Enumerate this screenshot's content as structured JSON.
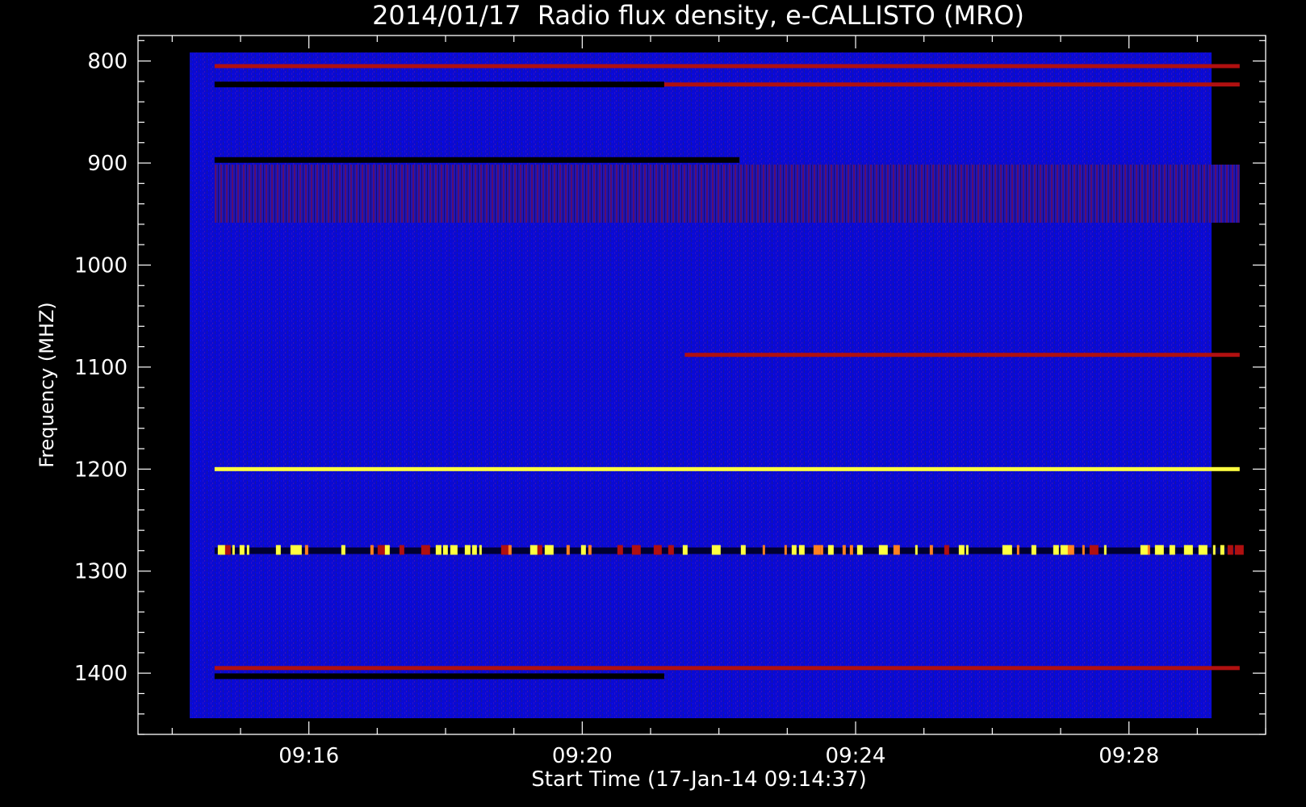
{
  "chart_data": {
    "type": "heatmap",
    "title": "2014/01/17  Radio flux density, e-CALLISTO (MRO)",
    "xlabel": "Start Time (17-Jan-14 09:14:37)",
    "ylabel": "Frequency (MHZ)",
    "x_range": [
      "09:14:37",
      "09:29:37"
    ],
    "xlim_minutes": [
      13.5,
      30.0
    ],
    "ylim": [
      1460,
      775
    ],
    "y_inverted": true,
    "x_ticks": [
      "09:16",
      "09:20",
      "09:24",
      "09:28"
    ],
    "x_tick_minutes": [
      16,
      20,
      24,
      28
    ],
    "y_ticks": [
      "800",
      "900",
      "1000",
      "1100",
      "1200",
      "1300",
      "1400"
    ],
    "y_tick_values": [
      800,
      900,
      1000,
      1100,
      1200,
      1300,
      1400
    ],
    "data_freq_range": [
      790,
      1450
    ],
    "colors": {
      "background": "#0a0ad2",
      "low": "#000000",
      "mid": "#b01010",
      "high": "#ffff40"
    },
    "features": [
      {
        "kind": "band",
        "freq": 805,
        "t_start": 14.62,
        "t_end": 29.62,
        "intensity": "mid"
      },
      {
        "kind": "band",
        "freq": 823,
        "t_start": 14.62,
        "t_end": 21.2,
        "intensity": "low"
      },
      {
        "kind": "band",
        "freq": 823,
        "t_start": 21.2,
        "t_end": 29.62,
        "intensity": "mid"
      },
      {
        "kind": "band",
        "freq": 897,
        "t_start": 14.62,
        "t_end": 22.3,
        "intensity": "low"
      },
      {
        "kind": "striped",
        "freq": 930,
        "t_start": 14.62,
        "t_end": 29.62,
        "intensity": "mid"
      },
      {
        "kind": "band",
        "freq": 1088,
        "t_start": 21.5,
        "t_end": 29.62,
        "intensity": "mid"
      },
      {
        "kind": "band",
        "freq": 1200,
        "t_start": 14.62,
        "t_end": 29.62,
        "intensity": "high"
      },
      {
        "kind": "bursts",
        "freq": 1280,
        "t_start": 14.62,
        "t_end": 29.62,
        "intensity": "high"
      },
      {
        "kind": "band",
        "freq": 1395,
        "t_start": 14.62,
        "t_end": 29.62,
        "intensity": "mid"
      },
      {
        "kind": "band",
        "freq": 1403,
        "t_start": 14.62,
        "t_end": 21.2,
        "intensity": "low"
      }
    ]
  }
}
